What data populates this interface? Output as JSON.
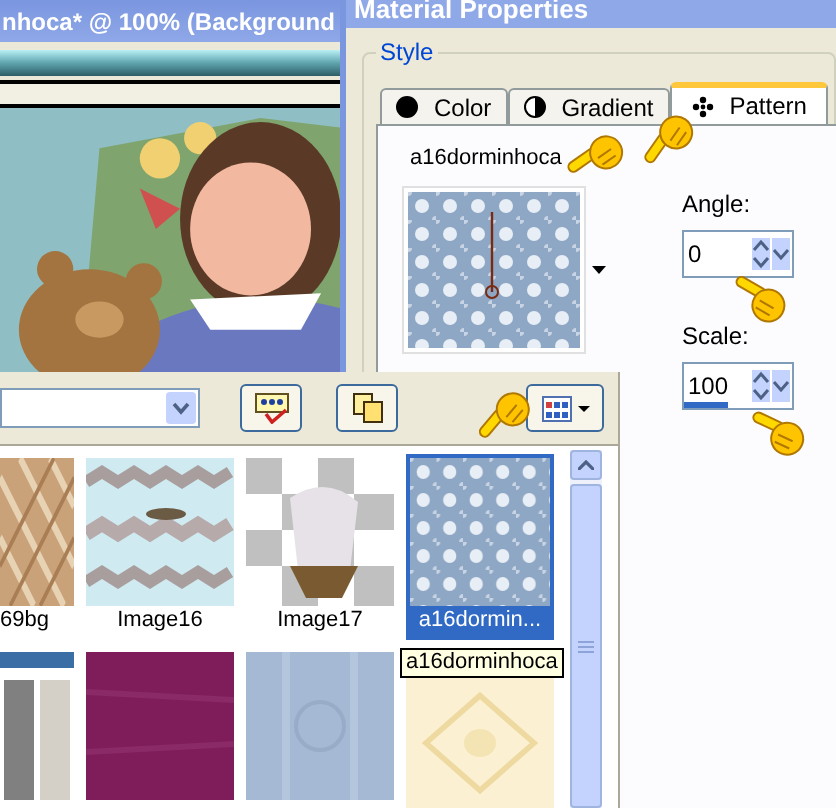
{
  "image_window": {
    "title": "nhoca* @ 100% (Background"
  },
  "dialog": {
    "title": "Material Properties",
    "group": "Style",
    "tabs": [
      {
        "label": "Color",
        "selected": false
      },
      {
        "label": "Gradient",
        "selected": false
      },
      {
        "label": "Pattern",
        "selected": true
      }
    ],
    "pattern_name": "a16dorminhoca",
    "angle": {
      "label": "Angle:",
      "value": "0"
    },
    "scale": {
      "label": "Scale:",
      "value": "100",
      "level": 0.4
    }
  },
  "picker": {
    "tiles": [
      {
        "label": "69bg",
        "selected": false
      },
      {
        "label": "Image16",
        "selected": false
      },
      {
        "label": "Image17",
        "selected": false
      },
      {
        "label": "a16dormin...",
        "selected": true
      },
      {
        "selected": false
      },
      {
        "selected": false
      },
      {
        "selected": false
      },
      {
        "selected": false
      }
    ],
    "tooltip": "a16dorminhoca"
  }
}
